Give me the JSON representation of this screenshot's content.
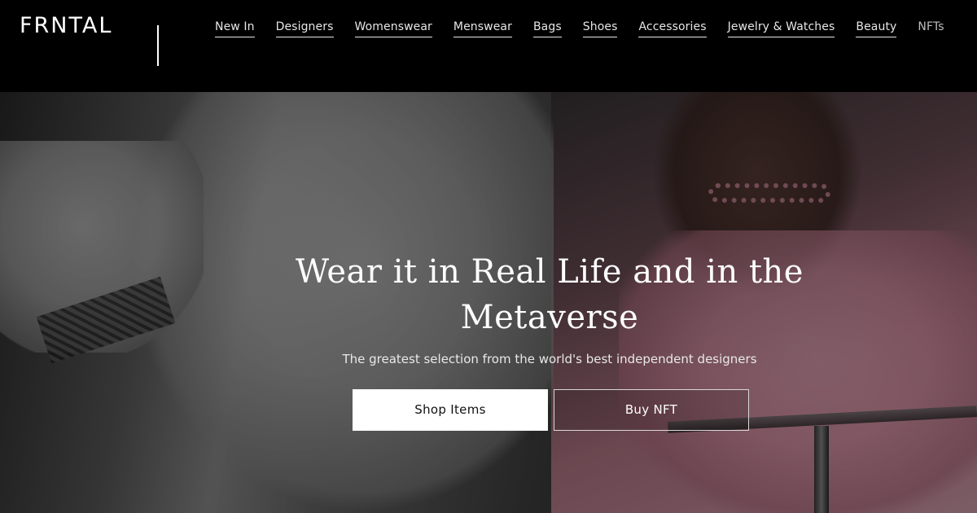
{
  "header": {
    "logo": "FRNTAL",
    "nav": [
      {
        "label": "New In"
      },
      {
        "label": "Designers"
      },
      {
        "label": "Womenswear"
      },
      {
        "label": "Menswear"
      },
      {
        "label": "Bags"
      },
      {
        "label": "Shoes"
      },
      {
        "label": "Accessories"
      },
      {
        "label": "Jewelry & Watches"
      },
      {
        "label": "Beauty"
      },
      {
        "label": "NFTs"
      }
    ]
  },
  "hero": {
    "headline": "Wear it in Real Life and in the Metaverse",
    "subtitle": "The greatest selection from the world's best independent designers",
    "primary_button": "Shop Items",
    "secondary_button": "Buy NFT"
  },
  "colors": {
    "header_bg": "#000000",
    "text": "#ffffff",
    "primary_button_bg": "#ffffff",
    "primary_button_text": "#111111"
  }
}
